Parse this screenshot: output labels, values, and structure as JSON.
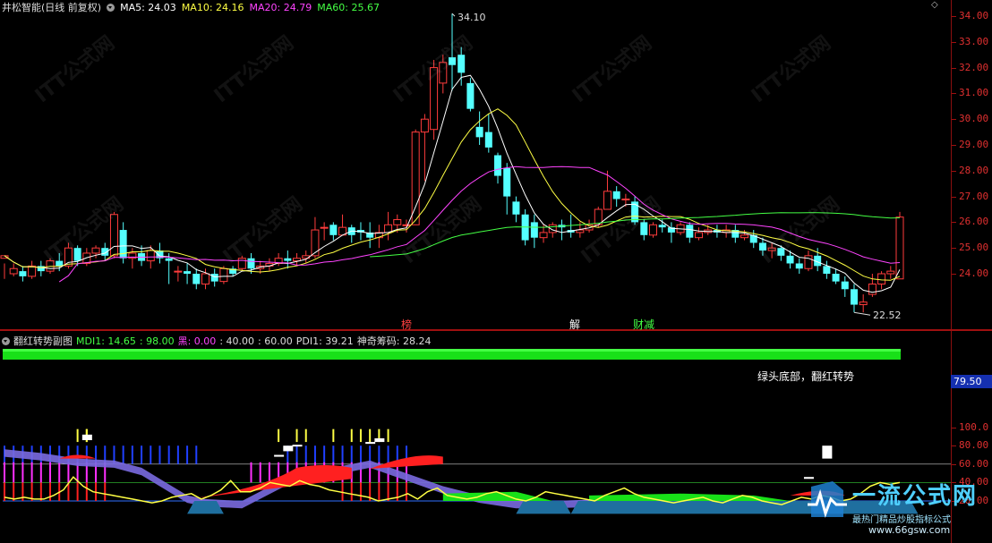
{
  "header": {
    "stock_name": "井松智能(日线 前复权)",
    "ma5": "MA5: 24.03",
    "ma10": "MA10: 24.16",
    "ma20": "MA20: 24.79",
    "ma60": "MA60: 25.67"
  },
  "sub_header": {
    "title": "翻红转势副图",
    "mdi": "MDI1: 14.65",
    "v98": ": 98.00",
    "hei": "黑: 0.00",
    "v40": ": 40.00",
    "v60": ": 60.00",
    "pdi": "PDI1: 39.21",
    "chip": "神奇筹码: 28.24"
  },
  "main_axis": [
    "34.00",
    "33.00",
    "32.00",
    "31.00",
    "30.00",
    "29.00",
    "28.00",
    "27.00",
    "26.00",
    "25.00",
    "24.00"
  ],
  "sub_axis": [
    "100.0",
    "80.00",
    "60.00",
    "40.00",
    "20.00"
  ],
  "badge_value": "79.50",
  "annotations": {
    "high_label": "34.10",
    "low_label": "22.52",
    "tag_bang": "榜",
    "tag_jie": "解",
    "tag_caijian": "财减",
    "signal_text": "绿头底部，翻红转势"
  },
  "watermark": {
    "brand": "一流公式网",
    "slogan": "最热门精品炒股指标公式",
    "url": "www.66gsw.com"
  },
  "colors": {
    "up": "#ff3c3c",
    "down": "#54ffff",
    "ma5": "#ffffff",
    "ma10": "#ffff44",
    "ma20": "#ff44ff",
    "ma60": "#44ff44"
  },
  "chart_data": {
    "type": "candlestick",
    "ylim": [
      22.3,
      34.4
    ],
    "candles": [
      [
        24.6,
        24.7,
        24.4,
        23.8
      ],
      [
        24.0,
        24.2,
        24.4,
        23.9
      ],
      [
        24.1,
        23.9,
        24.3,
        23.7
      ],
      [
        23.9,
        24.3,
        24.5,
        23.8
      ],
      [
        24.3,
        24.1,
        24.5,
        23.9
      ],
      [
        24.1,
        24.5,
        24.6,
        24.0
      ],
      [
        24.5,
        24.3,
        24.8,
        24.1
      ],
      [
        24.3,
        25.0,
        25.2,
        24.2
      ],
      [
        25.0,
        24.5,
        25.1,
        24.3
      ],
      [
        24.4,
        24.8,
        25.0,
        24.3
      ],
      [
        24.8,
        25.0,
        25.1,
        24.6
      ],
      [
        25.0,
        24.7,
        25.2,
        24.5
      ],
      [
        24.7,
        26.3,
        26.4,
        24.6
      ],
      [
        25.7,
        24.6,
        26.0,
        24.4
      ],
      [
        24.6,
        24.8,
        25.0,
        24.2
      ],
      [
        24.8,
        24.5,
        25.1,
        24.3
      ],
      [
        24.5,
        24.9,
        25.1,
        24.2
      ],
      [
        24.9,
        24.6,
        25.2,
        24.4
      ],
      [
        24.6,
        24.5,
        24.8,
        23.6
      ],
      [
        24.1,
        24.1,
        24.3,
        23.7
      ],
      [
        24.1,
        24.0,
        24.4,
        23.6
      ],
      [
        24.0,
        23.6,
        24.2,
        23.4
      ],
      [
        23.6,
        24.0,
        24.2,
        23.4
      ],
      [
        24.0,
        23.7,
        24.2,
        23.5
      ],
      [
        23.7,
        24.2,
        24.3,
        23.6
      ],
      [
        24.2,
        24.0,
        24.3,
        23.9
      ],
      [
        24.2,
        24.6,
        24.7,
        24.1
      ],
      [
        24.6,
        24.2,
        24.8,
        24.0
      ],
      [
        24.2,
        24.3,
        24.5,
        24.0
      ],
      [
        24.3,
        24.4,
        24.6,
        24.1
      ],
      [
        24.4,
        24.6,
        24.8,
        24.3
      ],
      [
        24.6,
        24.5,
        24.9,
        24.2
      ],
      [
        24.5,
        24.6,
        24.8,
        24.3
      ],
      [
        24.6,
        24.7,
        24.9,
        24.4
      ],
      [
        24.7,
        25.7,
        26.2,
        24.6
      ],
      [
        25.8,
        25.8,
        26.0,
        25.3
      ],
      [
        25.9,
        25.5,
        26.0,
        25.3
      ],
      [
        25.5,
        25.8,
        26.3,
        25.5
      ],
      [
        25.8,
        25.5,
        25.9,
        25.2
      ],
      [
        25.7,
        25.6,
        26.0,
        25.3
      ],
      [
        25.6,
        25.4,
        26.0,
        25.0
      ],
      [
        25.4,
        25.6,
        25.9,
        25.0
      ],
      [
        25.6,
        25.9,
        26.4,
        25.3
      ],
      [
        25.9,
        26.1,
        26.3,
        25.6
      ],
      [
        25.9,
        25.9,
        26.1,
        25.6
      ],
      [
        25.9,
        29.5,
        29.6,
        25.9
      ],
      [
        29.5,
        30.0,
        30.2,
        27.6
      ],
      [
        29.6,
        32.0,
        32.3,
        29.2
      ],
      [
        31.4,
        32.2,
        32.5,
        31.0
      ],
      [
        32.4,
        32.1,
        34.1,
        31.1
      ],
      [
        32.5,
        31.8,
        32.8,
        31.3
      ],
      [
        31.4,
        30.4,
        31.6,
        30.3
      ],
      [
        29.7,
        29.3,
        30.3,
        29.0
      ],
      [
        29.5,
        28.9,
        30.2,
        28.7
      ],
      [
        28.6,
        27.8,
        28.7,
        27.5
      ],
      [
        28.1,
        27.0,
        28.3,
        26.3
      ],
      [
        26.8,
        26.3,
        27.0,
        26.0
      ],
      [
        26.3,
        25.3,
        26.5,
        25.1
      ],
      [
        26.0,
        25.4,
        26.3,
        25.0
      ],
      [
        25.4,
        25.6,
        25.9,
        25.2
      ],
      [
        25.6,
        25.9,
        26.0,
        25.4
      ],
      [
        25.9,
        25.8,
        26.1,
        25.3
      ],
      [
        25.7,
        25.6,
        26.3,
        25.4
      ],
      [
        25.6,
        25.7,
        26.0,
        25.4
      ],
      [
        25.7,
        25.9,
        26.1,
        25.6
      ],
      [
        25.9,
        26.5,
        26.6,
        25.8
      ],
      [
        26.5,
        27.2,
        28.0,
        26.5
      ],
      [
        27.2,
        26.9,
        27.4,
        26.6
      ],
      [
        26.9,
        26.9,
        27.1,
        26.6
      ],
      [
        26.8,
        26.0,
        27.0,
        25.9
      ],
      [
        26.0,
        25.5,
        26.1,
        25.3
      ],
      [
        25.5,
        25.9,
        26.0,
        25.4
      ],
      [
        25.9,
        25.8,
        26.1,
        25.6
      ],
      [
        25.8,
        25.6,
        26.0,
        25.2
      ],
      [
        25.6,
        25.9,
        26.0,
        25.5
      ],
      [
        25.9,
        25.4,
        26.0,
        25.2
      ],
      [
        25.4,
        25.6,
        25.8,
        25.3
      ],
      [
        25.6,
        25.7,
        25.9,
        25.5
      ],
      [
        25.7,
        25.6,
        25.9,
        25.4
      ],
      [
        25.6,
        25.7,
        25.9,
        25.4
      ],
      [
        25.7,
        25.4,
        25.9,
        25.2
      ],
      [
        25.4,
        25.5,
        25.7,
        25.3
      ],
      [
        25.5,
        25.2,
        25.7,
        25.0
      ],
      [
        25.2,
        24.9,
        25.4,
        24.7
      ],
      [
        24.9,
        25.0,
        25.2,
        24.6
      ],
      [
        25.0,
        24.7,
        25.1,
        24.5
      ],
      [
        24.7,
        24.4,
        24.9,
        24.2
      ],
      [
        24.4,
        24.2,
        24.6,
        24.0
      ],
      [
        24.2,
        24.7,
        24.9,
        24.1
      ],
      [
        24.7,
        24.3,
        25.0,
        24.1
      ],
      [
        24.3,
        24.0,
        24.5,
        23.8
      ],
      [
        24.0,
        23.7,
        24.2,
        23.6
      ],
      [
        23.7,
        23.4,
        23.9,
        23.1
      ],
      [
        23.4,
        22.8,
        23.6,
        22.5
      ],
      [
        22.8,
        22.9,
        23.2,
        22.5
      ],
      [
        23.2,
        23.6,
        24.0,
        23.1
      ],
      [
        23.6,
        24.0,
        24.1,
        23.4
      ],
      [
        24.0,
        24.1,
        24.3,
        23.8
      ],
      [
        23.8,
        26.2,
        26.4,
        23.8
      ]
    ]
  }
}
